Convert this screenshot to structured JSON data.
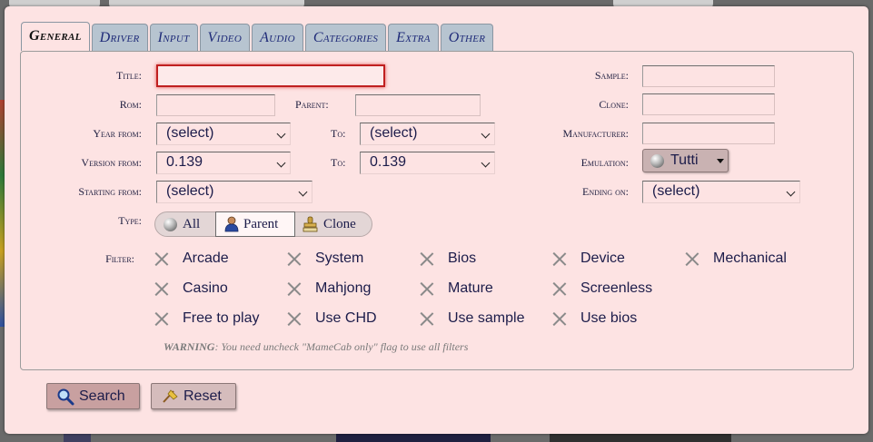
{
  "tabs": [
    {
      "label": "General",
      "active": true
    },
    {
      "label": "Driver"
    },
    {
      "label": "Input"
    },
    {
      "label": "Video"
    },
    {
      "label": "Audio"
    },
    {
      "label": "Categories"
    },
    {
      "label": "Extra"
    },
    {
      "label": "Other"
    }
  ],
  "form": {
    "title_label": "Title:",
    "title_value": "",
    "rom_label": "Rom:",
    "rom_value": "",
    "parent_label": "Parent:",
    "parent_value": "",
    "year_from_label": "Year from:",
    "year_from_value": "(select)",
    "year_to_label": "To:",
    "year_to_value": "(select)",
    "version_from_label": "Version from:",
    "version_from_value": "0.139",
    "version_to_label": "To:",
    "version_to_value": "0.139",
    "starting_from_label": "Starting from:",
    "starting_from_value": "(select)",
    "sample_label": "Sample:",
    "sample_value": "",
    "clone_label": "Clone:",
    "clone_value": "",
    "manufacturer_label": "Manufacturer:",
    "manufacturer_value": "",
    "emulation_label": "Emulation:",
    "emulation_value": "Tutti",
    "ending_on_label": "Ending on:",
    "ending_on_value": "(select)",
    "type_label": "Type:",
    "type_options": [
      "All",
      "Parent",
      "Clone"
    ],
    "type_selected": "Parent",
    "filter_label": "Filter:"
  },
  "filters": [
    [
      "Arcade",
      "System",
      "Bios",
      "Device",
      "Mechanical"
    ],
    [
      "Casino",
      "Mahjong",
      "Mature",
      "Screenless"
    ],
    [
      "Free to play",
      "Use CHD",
      "Use sample",
      "Use bios"
    ]
  ],
  "warning": {
    "prefix": "WARNING",
    "text": ": You need uncheck \"MameCab only\" flag to use all filters"
  },
  "actions": {
    "search_label": "Search",
    "reset_label": "Reset"
  },
  "icons": {
    "search": "magnifier-icon",
    "reset": "broom-icon",
    "all": "orb-icon",
    "parent": "person-icon",
    "clone": "stamp-icon"
  },
  "colors": {
    "dialog_bg": "#fde3e3",
    "tab_bg": "#b7c4d0",
    "focus_border": "#c02020",
    "button_bg": "#d5bcbc"
  }
}
